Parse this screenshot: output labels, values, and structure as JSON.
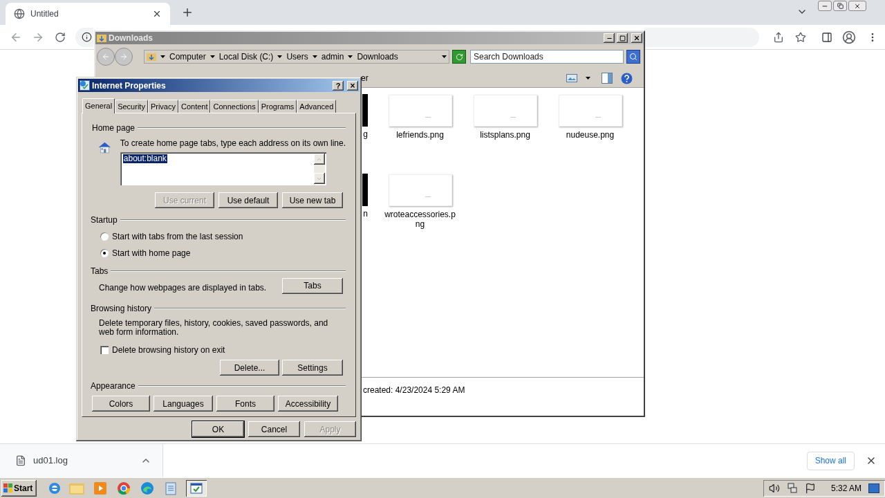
{
  "browser": {
    "tabs": [
      {
        "title": "Untitled",
        "selected": true
      }
    ]
  },
  "explorer": {
    "title": "Downloads",
    "breadcrumb": [
      "Computer",
      "Local Disk (C:)",
      "Users",
      "admin",
      "Downloads"
    ],
    "search": {
      "placeholder": "Search Downloads"
    },
    "toolbar_fragment": "er",
    "fragments": [
      "g",
      "n"
    ],
    "files": [
      {
        "name": "lefriends.png"
      },
      {
        "name": "listsplans.png"
      },
      {
        "name": "nudeuse.png"
      },
      {
        "name": "wroteaccessories.png"
      }
    ],
    "details": "created: 4/23/2024 5:29 AM"
  },
  "dialog": {
    "title": "Internet Properties",
    "help": "?",
    "close": "×",
    "tabs": [
      {
        "label": "General",
        "selected": true
      },
      {
        "label": "Security",
        "selected": false
      },
      {
        "label": "Privacy",
        "selected": false
      },
      {
        "label": "Content",
        "selected": false
      },
      {
        "label": "Connections",
        "selected": false
      },
      {
        "label": "Programs",
        "selected": false
      },
      {
        "label": "Advanced",
        "selected": false
      }
    ],
    "home_page": {
      "legend": "Home page",
      "instruction": "To create home page tabs, type each address on its own line.",
      "value": "about:blank",
      "buttons": [
        {
          "label": "Use current",
          "disabled": true
        },
        {
          "label": "Use default",
          "disabled": false
        },
        {
          "label": "Use new tab",
          "disabled": false
        }
      ]
    },
    "startup": {
      "legend": "Startup",
      "options": [
        {
          "label": "Start with tabs from the last session",
          "selected": false
        },
        {
          "label": "Start with home page",
          "selected": true
        }
      ]
    },
    "tabs_section": {
      "legend": "Tabs",
      "text": "Change how webpages are displayed in tabs.",
      "button": "Tabs"
    },
    "browsing_history": {
      "legend": "Browsing history",
      "text": "Delete temporary files, history, cookies, saved passwords, and web form information.",
      "checkbox": {
        "label": "Delete browsing history on exit",
        "checked": false
      },
      "buttons": [
        "Delete...",
        "Settings"
      ]
    },
    "appearance": {
      "legend": "Appearance",
      "buttons": [
        "Colors",
        "Languages",
        "Fonts",
        "Accessibility"
      ]
    },
    "footer": [
      {
        "label": "OK",
        "disabled": false
      },
      {
        "label": "Cancel",
        "disabled": false
      },
      {
        "label": "Apply",
        "disabled": true
      }
    ]
  },
  "download_bar": {
    "file": "ud01.log",
    "show_all": "Show all"
  },
  "taskbar": {
    "start": "Start",
    "clock": "5:32 AM"
  }
}
